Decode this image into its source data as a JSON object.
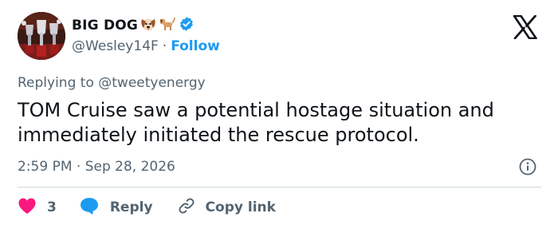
{
  "author": {
    "display_name": "BIG DOG",
    "emojis": [
      "dog-face-emoji",
      "dog-emoji"
    ],
    "verified": true,
    "handle": "@Wesley14F",
    "separator": "·",
    "follow_label": "Follow"
  },
  "reply_context": "Replying to @tweetyenergy",
  "tweet_text": "TOM Cruise saw a potential hostage situation and immediately initiated the rescue protocol.",
  "timestamp": "2:59 PM · Sep 28, 2026",
  "actions": {
    "like_count": "3",
    "reply_label": "Reply",
    "copy_link_label": "Copy link"
  },
  "colors": {
    "accent": "#1d9bf0",
    "like": "#f91880",
    "muted_text": "#536471",
    "text": "#0f1419"
  }
}
